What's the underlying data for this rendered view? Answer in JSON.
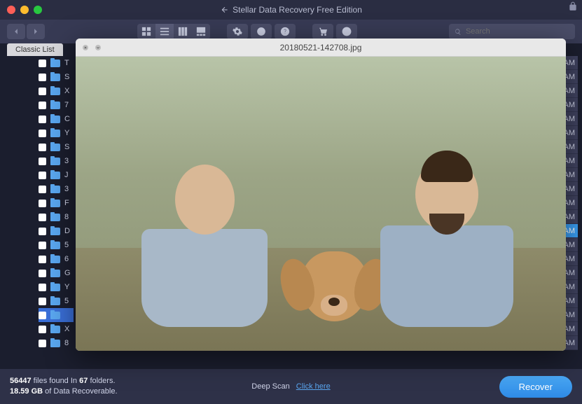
{
  "app": {
    "title": "Stellar Data Recovery Free Edition"
  },
  "sidebar": {
    "tab_label": "Classic List"
  },
  "toolbar": {
    "search_placeholder": "Search"
  },
  "preview": {
    "filename": "20180521-142708.jpg"
  },
  "files": {
    "letters": [
      "T",
      "S",
      "X",
      "7",
      "C",
      "Y",
      "S",
      "3",
      "J",
      "3",
      "F",
      "8",
      "D",
      "5",
      "6",
      "G",
      "Y",
      "5",
      "",
      "X",
      "8"
    ],
    "selected_index": 18
  },
  "times": {
    "label": "AM",
    "count": 21,
    "selected_index": 12
  },
  "status": {
    "files_count": "56447",
    "files_text_1": "files found",
    "files_text_2": "In",
    "folders_count": "67",
    "folders_text": "folders.",
    "size": "18.59 GB",
    "size_text_1": "of Data",
    "size_text_2": "Recoverable.",
    "deep_scan_label": "Deep Scan",
    "deep_scan_link": "Click here",
    "recover_label": "Recover"
  }
}
